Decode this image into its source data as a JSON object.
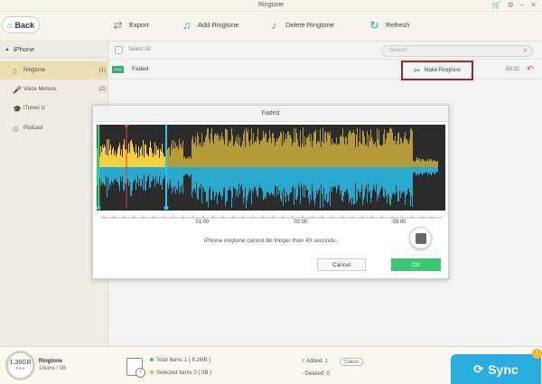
{
  "window": {
    "title": "Ringtone"
  },
  "toolbar": {
    "back_label": "Back",
    "export_label": "Export",
    "add_label": "Add Ringtone",
    "delete_label": "Delete Ringtone",
    "refresh_label": "Refresh"
  },
  "sidebar": {
    "device": "iPhone",
    "items": [
      {
        "label": "Ringtone",
        "count": "(1)",
        "icon": "bell-icon"
      },
      {
        "label": "Voice Memos",
        "count": "(2)",
        "icon": "microphone-icon"
      },
      {
        "label": "iTunes U",
        "count": "",
        "icon": "graduation-icon"
      },
      {
        "label": "Podcast",
        "count": "",
        "icon": "podcast-icon"
      }
    ]
  },
  "list": {
    "select_all_label": "Select All",
    "search_placeholder": "Search",
    "rows": [
      {
        "badge": "New",
        "name": "Faded",
        "action": "Make Ringtone",
        "duration": "03:32"
      }
    ]
  },
  "dialog": {
    "title": "Faded",
    "timeline_labels": [
      "01:00",
      "02:00",
      "03:00"
    ],
    "message": "iPhone ringtone cannot be longer than 40 seconds.",
    "cancel_label": "Cancel",
    "ok_label": "OK"
  },
  "footer": {
    "storage_value": "1.39GB",
    "storage_label": "Free",
    "category": "Ringtone",
    "category_sub": "1items / 0B",
    "total_items": "Total Items 1 ( 8.2MB )",
    "selected_items": "Selected Items 0 ( 0B )",
    "added": "+ Added: 1",
    "deleted": "- Deleted: 0",
    "cancel_label": "Cancel",
    "sync_label": "Sync",
    "sync_badge": "1"
  },
  "colors": {
    "accent": "#2aaee0",
    "ok_green": "#3bc673",
    "highlight_red": "#9a1b1b",
    "wave_gold": "#b59a3a",
    "wave_blue": "#29a9cf",
    "wave_selected_gold": "#f5d13d"
  }
}
